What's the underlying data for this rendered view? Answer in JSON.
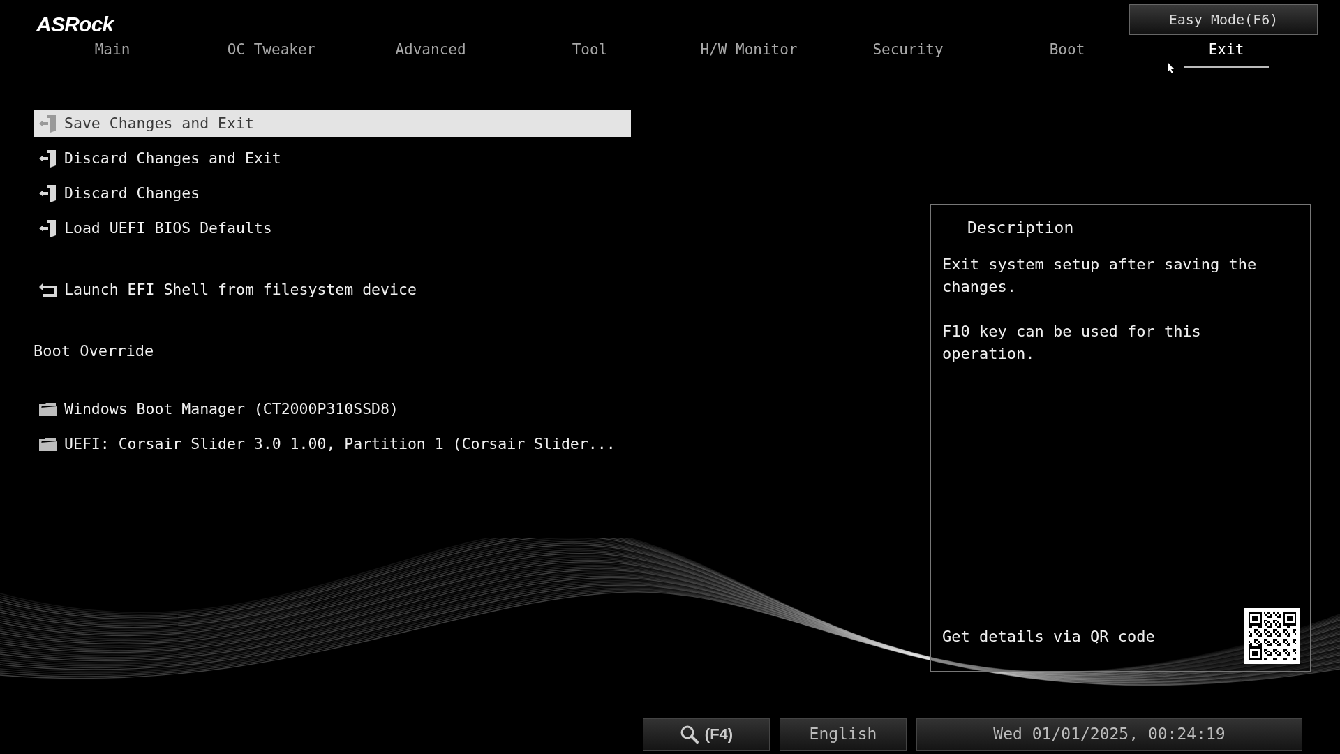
{
  "logo": "ASRock",
  "easy_mode_button": "Easy Mode(F6)",
  "tabs": [
    {
      "label": "Main",
      "selected": false
    },
    {
      "label": "OC Tweaker",
      "selected": false
    },
    {
      "label": "Advanced",
      "selected": false
    },
    {
      "label": "Tool",
      "selected": false
    },
    {
      "label": "H/W Monitor",
      "selected": false
    },
    {
      "label": "Security",
      "selected": false
    },
    {
      "label": "Boot",
      "selected": false
    },
    {
      "label": "Exit",
      "selected": true
    }
  ],
  "menu": [
    {
      "kind": "action",
      "label": "Save Changes and Exit",
      "selected": true
    },
    {
      "kind": "action",
      "label": "Discard Changes and Exit",
      "selected": false
    },
    {
      "kind": "action",
      "label": "Discard Changes",
      "selected": false
    },
    {
      "kind": "action",
      "label": "Load UEFI BIOS Defaults",
      "selected": false
    },
    {
      "kind": "shell",
      "label": "Launch EFI Shell from filesystem device",
      "selected": false
    }
  ],
  "boot_override": {
    "title": "Boot Override",
    "items": [
      {
        "label": "Windows Boot Manager (CT2000P310SSD8)",
        "selected": false
      },
      {
        "label": "UEFI: Corsair Slider 3.0 1.00, Partition 1 (Corsair Slider...",
        "selected": false
      }
    ]
  },
  "description": {
    "title": "Description",
    "paragraphs": [
      "Exit system setup after saving the changes.",
      "F10 key can be used for this operation."
    ],
    "qr_label": "Get details via QR code"
  },
  "status_bar": {
    "search": "(F4)",
    "language": "English",
    "datetime": "Wed 01/01/2025, 00:24:19"
  }
}
